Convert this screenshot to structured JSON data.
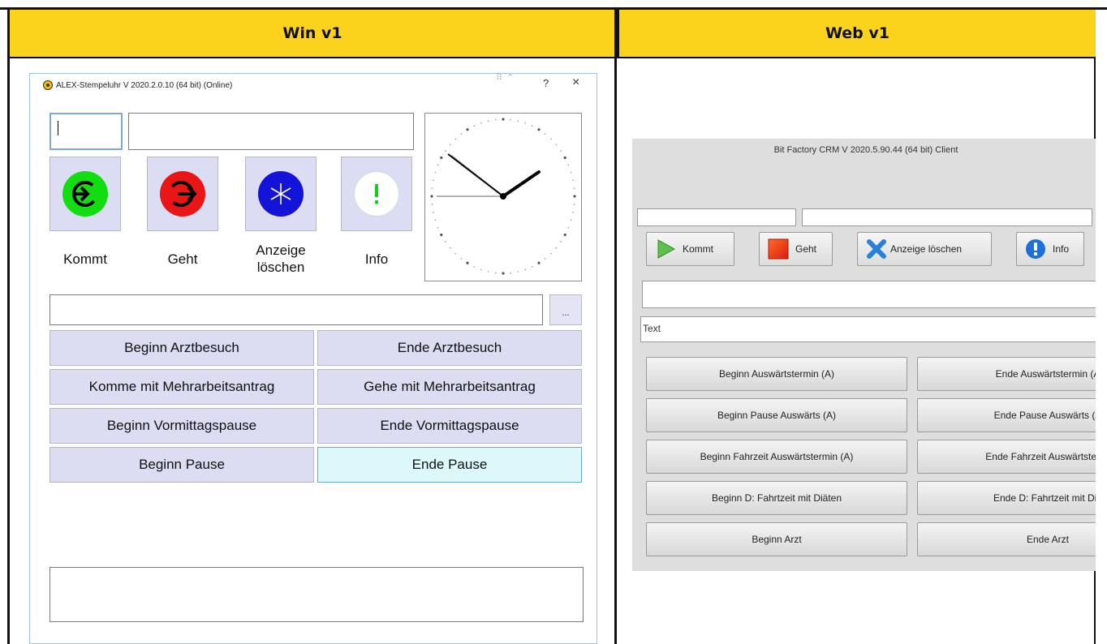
{
  "table": {
    "col_left_header": "Win v1",
    "col_right_header": "Web v1",
    "header_color": "#fcd31c"
  },
  "win": {
    "title": "ALEX-Stempeluhr V 2020.2.0.10 (64 bit) (Online)",
    "ctrl_help": "?",
    "ctrl_close": "×",
    "mini_controls": "⠿ ⌃",
    "id_input_value": "",
    "name_input_value": "",
    "buttons": [
      {
        "label": "Kommt",
        "icon": "arrow-in-icon",
        "glyph": "➔"
      },
      {
        "label": "Geht",
        "icon": "arrow-out-icon",
        "glyph": "➔"
      },
      {
        "label": "Anzeige löschen",
        "icon": "clear-display-icon",
        "glyph": "✳"
      },
      {
        "label": "Info",
        "icon": "info-icon",
        "glyph": "!"
      }
    ],
    "comment_input_value": "",
    "more_button": "...",
    "grid": [
      {
        "left": "Beginn Arztbesuch",
        "right": "Ende Arztbesuch"
      },
      {
        "left": "Komme mit Mehrarbeitsantrag",
        "right": "Gehe mit Mehrarbeitsantrag"
      },
      {
        "left": "Beginn Vormittagspause",
        "right": "Ende Vormittagspause"
      },
      {
        "left": "Beginn Pause",
        "right": "Ende Pause"
      }
    ],
    "message_box_value": ""
  },
  "web": {
    "title": "Bit Factory CRM V 2020.5.90.44 (64 bit) Client",
    "buttons": [
      {
        "label": "Kommt",
        "icon": "play-icon"
      },
      {
        "label": "Geht",
        "icon": "stop-icon"
      },
      {
        "label": "Anzeige löschen",
        "icon": "clear-x-icon"
      },
      {
        "label": "Info",
        "icon": "info-icon"
      }
    ],
    "text_field_value": "Text",
    "grid": [
      {
        "left": "Beginn Auswärtstermin (A)",
        "right": "Ende Auswärtstermin (A"
      },
      {
        "left": "Beginn Pause Auswärts (A)",
        "right": "Ende Pause Auswärts (A"
      },
      {
        "left": "Beginn Fahrzeit Auswärtstermin (A)",
        "right": "Ende Fahrzeit Auswärtstermi"
      },
      {
        "left": "Beginn D: Fahrtzeit mit Diäten",
        "right": "Ende D: Fahrtzeit mit Diä"
      },
      {
        "left": "Beginn Arzt",
        "right": "Ende Arzt"
      }
    ]
  }
}
